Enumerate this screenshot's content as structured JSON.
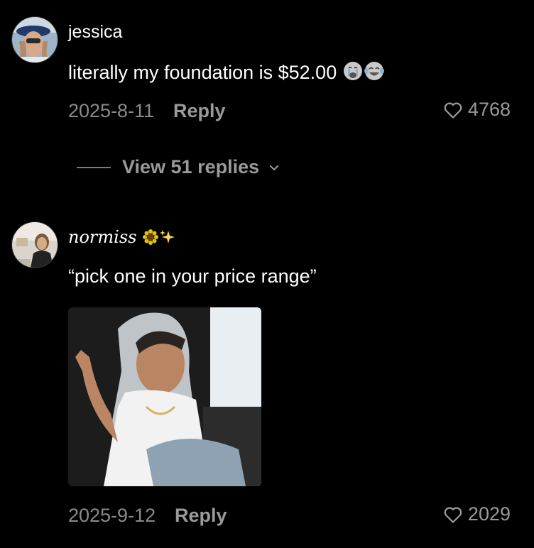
{
  "comments": [
    {
      "username": "jessica",
      "text": "literally my foundation is $52.00",
      "emojis": [
        "loudly-crying-face",
        "tears-of-joy-face"
      ],
      "date": "2025-8-11",
      "reply_label": "Reply",
      "likes": "4768",
      "view_replies_label": "View 51 replies"
    },
    {
      "username": "normiss",
      "username_emojis": [
        "sunflower",
        "sparkles"
      ],
      "text": "“pick one in your price range”",
      "attachment": "gif-image",
      "date": "2025-9-12",
      "reply_label": "Reply",
      "likes": "2029"
    }
  ],
  "colors": {
    "background": "#000000",
    "primary_text": "#ffffff",
    "secondary_text": "#8a8a8a"
  }
}
